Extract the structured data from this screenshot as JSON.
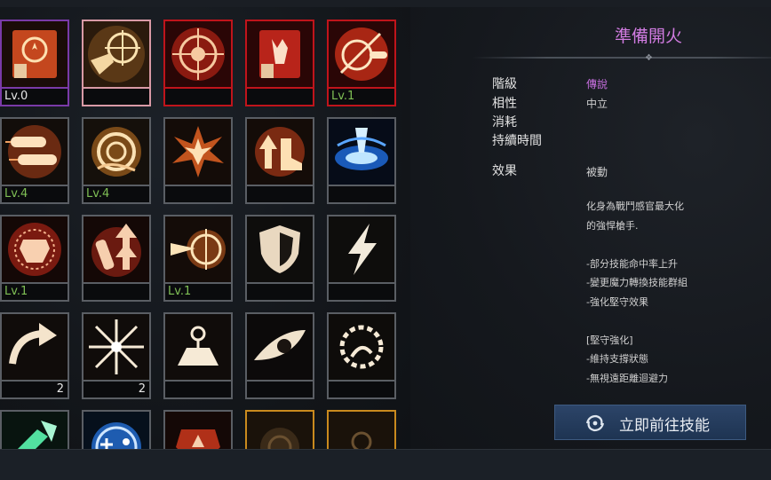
{
  "skills": [
    {
      "id": "cell-1",
      "frame": "purple",
      "level": "Lv.0",
      "level_color": "white",
      "count": ""
    },
    {
      "id": "cell-2",
      "frame": "pink",
      "level": "",
      "level_color": "",
      "count": ""
    },
    {
      "id": "cell-3",
      "frame": "red",
      "level": "",
      "level_color": "",
      "count": ""
    },
    {
      "id": "cell-4",
      "frame": "red",
      "level": "",
      "level_color": "",
      "count": ""
    },
    {
      "id": "cell-5",
      "frame": "red",
      "level": "Lv.1",
      "level_color": "green",
      "count": ""
    },
    {
      "id": "cell-6",
      "frame": "gray",
      "level": "Lv.4",
      "level_color": "green",
      "count": ""
    },
    {
      "id": "cell-7",
      "frame": "gray",
      "level": "Lv.4",
      "level_color": "green",
      "count": ""
    },
    {
      "id": "cell-8",
      "frame": "gray",
      "level": "",
      "level_color": "",
      "count": ""
    },
    {
      "id": "cell-9",
      "frame": "gray",
      "level": "",
      "level_color": "",
      "count": ""
    },
    {
      "id": "cell-10",
      "frame": "gray",
      "level": "",
      "level_color": "",
      "count": ""
    },
    {
      "id": "cell-11",
      "frame": "gray",
      "level": "Lv.1",
      "level_color": "green",
      "count": ""
    },
    {
      "id": "cell-12",
      "frame": "gray",
      "level": "",
      "level_color": "",
      "count": ""
    },
    {
      "id": "cell-13",
      "frame": "gray",
      "level": "Lv.1",
      "level_color": "green",
      "count": ""
    },
    {
      "id": "cell-14",
      "frame": "gray",
      "level": "",
      "level_color": "",
      "count": ""
    },
    {
      "id": "cell-15",
      "frame": "gray",
      "level": "",
      "level_color": "",
      "count": ""
    },
    {
      "id": "cell-16",
      "frame": "gray",
      "level": "",
      "level_color": "",
      "count": "2"
    },
    {
      "id": "cell-17",
      "frame": "gray",
      "level": "",
      "level_color": "",
      "count": "2"
    },
    {
      "id": "cell-18",
      "frame": "gray",
      "level": "",
      "level_color": "",
      "count": ""
    },
    {
      "id": "cell-19",
      "frame": "gray",
      "level": "",
      "level_color": "",
      "count": ""
    },
    {
      "id": "cell-20",
      "frame": "gray",
      "level": "",
      "level_color": "",
      "count": ""
    },
    {
      "id": "cell-21",
      "frame": "gray",
      "level": "",
      "level_color": "",
      "count": ""
    },
    {
      "id": "cell-22",
      "frame": "gray",
      "level": "",
      "level_color": "",
      "count": ""
    },
    {
      "id": "cell-23",
      "frame": "gray",
      "level": "",
      "level_color": "",
      "count": ""
    },
    {
      "id": "cell-24",
      "frame": "gold",
      "level": "",
      "level_color": "",
      "count": ""
    },
    {
      "id": "cell-25",
      "frame": "gold",
      "level": "",
      "level_color": "",
      "count": ""
    }
  ],
  "detail": {
    "title": "準備開火",
    "labels": {
      "grade": "階級",
      "affinity": "相性",
      "cost": "消耗",
      "duration": "持續時間",
      "effect": "效果"
    },
    "values": {
      "grade": "傳說",
      "affinity": "中立",
      "effect": "被動"
    },
    "description": [
      "化身為戰鬥感官最大化",
      "的強悍槍手.",
      "",
      "-部分技能命中率上升",
      "-變更魔力轉換技能群組",
      "-強化堅守效果",
      "",
      "[堅守強化]",
      "-維持支撐狀態",
      "-無視遠距離迴避力"
    ]
  },
  "go_button": {
    "label": "立即前往技能"
  },
  "colors": {
    "accent_purple": "#c86fe0",
    "level_green": "#7fbf55",
    "frame_red": "#c0141b",
    "frame_gold": "#c98a1e",
    "button_blue": "#2c4468"
  }
}
